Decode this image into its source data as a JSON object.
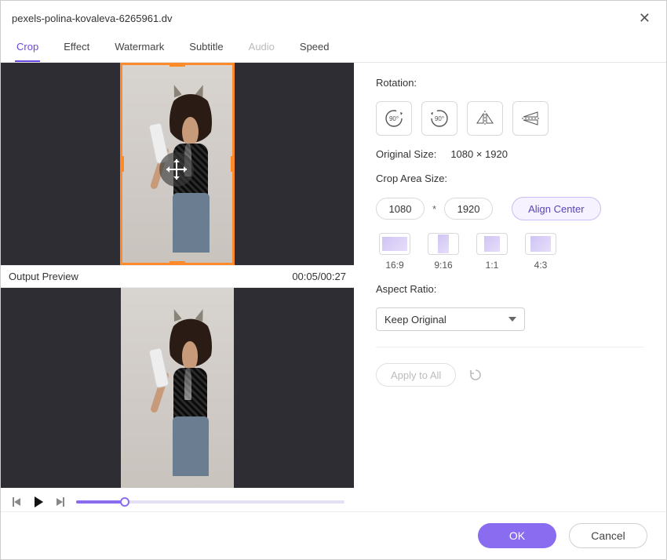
{
  "title": "pexels-polina-kovaleva-6265961.dv",
  "tabs": {
    "crop": "Crop",
    "effect": "Effect",
    "watermark": "Watermark",
    "subtitle": "Subtitle",
    "audio": "Audio",
    "speed": "Speed"
  },
  "preview": {
    "output_label": "Output Preview",
    "timecode": "00:05/00:27"
  },
  "rotation": {
    "label": "Rotation:"
  },
  "original_size": {
    "label": "Original Size:",
    "value": "1080 × 1920"
  },
  "crop_area": {
    "label": "Crop Area Size:",
    "width": "1080",
    "height": "1920",
    "separator": "*",
    "align_center": "Align Center"
  },
  "ratios": {
    "r169": "16:9",
    "r916": "9:16",
    "r11": "1:1",
    "r43": "4:3"
  },
  "aspect": {
    "label": "Aspect Ratio:",
    "value": "Keep Original"
  },
  "apply_all": "Apply to All",
  "footer": {
    "ok": "OK",
    "cancel": "Cancel"
  }
}
